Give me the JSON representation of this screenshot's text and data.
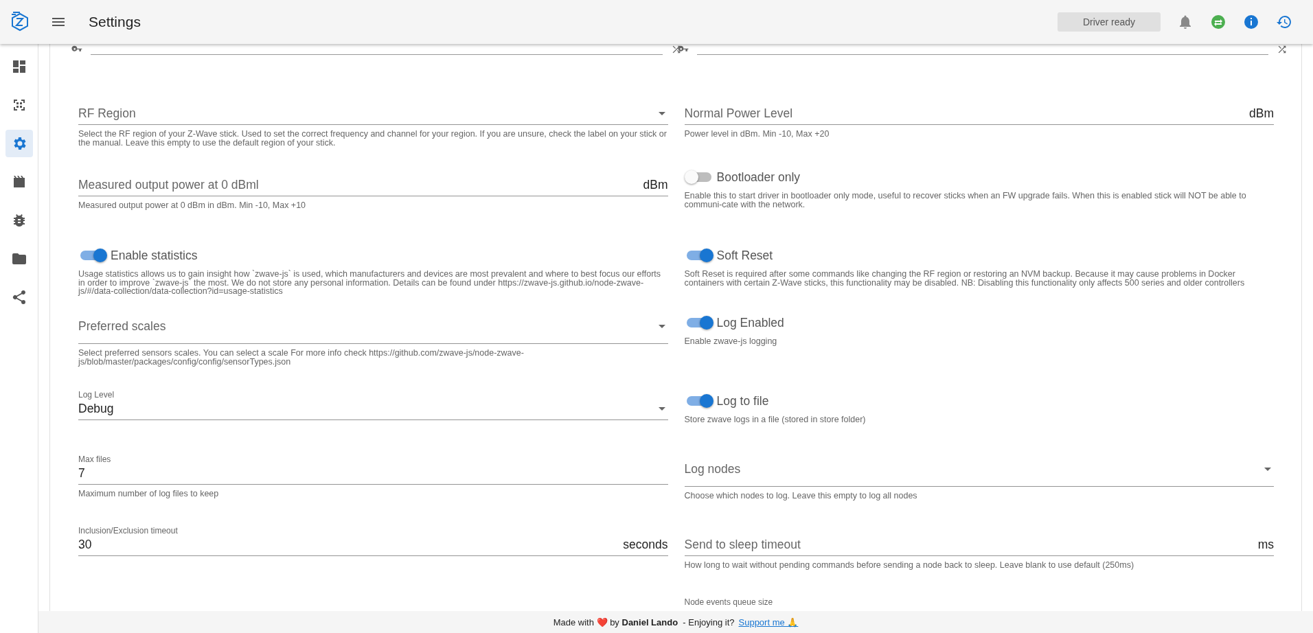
{
  "header": {
    "title": "Settings",
    "status": "Driver ready"
  },
  "nav": [
    {
      "selected": false
    },
    {
      "selected": false
    },
    {
      "selected": true
    },
    {
      "selected": false
    },
    {
      "selected": false
    },
    {
      "selected": false
    },
    {
      "selected": false
    }
  ],
  "rows": [
    [
      {
        "kind": "key"
      },
      {
        "kind": "key"
      }
    ],
    [
      {
        "kind": "select",
        "label": "RF Region",
        "hint": "Select the RF region of your Z-Wave stick. Used to set the correct frequency and channel for your region. If you are unsure, check the label on your stick or the manual. Leave this empty to use the default region of your stick."
      },
      {
        "kind": "text",
        "label": "Normal Power Level",
        "suffix": "dBm",
        "hint": "Power level in dBm. Min -10, Max +20"
      }
    ],
    [
      {
        "kind": "text",
        "label": "Measured output power at 0 dBml",
        "suffix": "dBm",
        "hint": "Measured output power at 0 dBm in dBm. Min -10, Max +10"
      },
      {
        "kind": "switch",
        "label": "Bootloader only",
        "on": false,
        "hint": "Enable this to start driver in bootloader only mode, useful to recover sticks when an FW upgrade fails. When this is enabled stick will NOT be able to communi-cate with the network."
      }
    ],
    [
      {
        "kind": "switch",
        "label": "Enable statistics",
        "on": true,
        "hint": "Usage statistics allows us to gain insight how `zwave-js` is used, which manufacturers and devices are most prevalent and where to best focus our efforts in order to improve `zwave-js` the most. We do not store any personal information. Details can be found under https://zwave-js.github.io/node-zwave-js/#/data-collection/data-collection?id=usage-statistics"
      },
      {
        "kind": "switch",
        "label": "Soft Reset",
        "on": true,
        "hint": "Soft Reset is required after some commands like changing the RF region or restoring an NVM backup. Because it may cause problems in Docker containers with certain Z-Wave sticks, this functionality may be disabled. NB: Disabling this functionality only affects 500 series and older controllers"
      }
    ],
    [
      {
        "kind": "multiselect",
        "label": "Preferred scales",
        "hint": "Select preferred sensors scales. You can select a scale For more info check https://github.com/zwave-js/node-zwave-js/blob/master/packages/config/config/sensorTypes.json"
      },
      {
        "kind": "switch",
        "label": "Log Enabled",
        "on": true,
        "hint": "Enable zwave-js logging"
      }
    ],
    [
      {
        "kind": "select",
        "label": "Log Level",
        "value": "Debug"
      },
      {
        "kind": "switch",
        "label": "Log to file",
        "on": true,
        "hint": "Store zwave logs in a file (stored in store folder)"
      }
    ],
    [
      {
        "kind": "text",
        "label": "Max files",
        "value": "7",
        "hint": "Maximum number of log files to keep"
      },
      {
        "kind": "multiselect",
        "label": "Log nodes",
        "hint": "Choose which nodes to log. Leave this empty to log all nodes"
      }
    ],
    [
      {
        "kind": "text",
        "label": "Inclusion/Exclusion timeout",
        "value": "30",
        "suffix": "seconds"
      },
      {
        "kind": "text",
        "label": "Send to sleep timeout",
        "suffix": "ms",
        "hint": "How long to wait without pending commands before sending a node back to sleep. Leave blank to use default (250ms)"
      }
    ],
    [
      {
        "kind": "blank"
      },
      {
        "kind": "label",
        "label": "Node events queue size"
      }
    ]
  ],
  "footer": {
    "text": "Made with ❤️ by **Daniel Lando**  - Enjoying it?",
    "link": "Support me 🙏"
  }
}
